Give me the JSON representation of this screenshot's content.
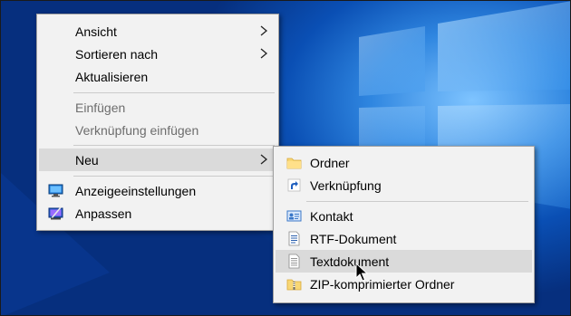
{
  "context_menu": {
    "items": [
      {
        "label": "Ansicht"
      },
      {
        "label": "Sortieren nach"
      },
      {
        "label": "Aktualisieren"
      },
      {
        "label": "Einfügen"
      },
      {
        "label": "Verknüpfung einfügen"
      },
      {
        "label": "Neu"
      },
      {
        "label": "Anzeigeeinstellungen"
      },
      {
        "label": "Anpassen"
      }
    ]
  },
  "new_submenu": {
    "items": [
      {
        "label": "Ordner",
        "icon": "folder-icon"
      },
      {
        "label": "Verknüpfung",
        "icon": "shortcut-icon"
      },
      {
        "label": "Kontakt",
        "icon": "contact-icon"
      },
      {
        "label": "RTF-Dokument",
        "icon": "rtf-document-icon"
      },
      {
        "label": "Textdokument",
        "icon": "text-document-icon"
      },
      {
        "label": "ZIP-komprimierter Ordner",
        "icon": "zip-folder-icon"
      }
    ]
  },
  "colors": {
    "menu_background": "#f2f2f2",
    "hover_background": "#dadada",
    "disabled_text": "#6d6d6d",
    "desktop_blue": "#0a4fb4"
  }
}
